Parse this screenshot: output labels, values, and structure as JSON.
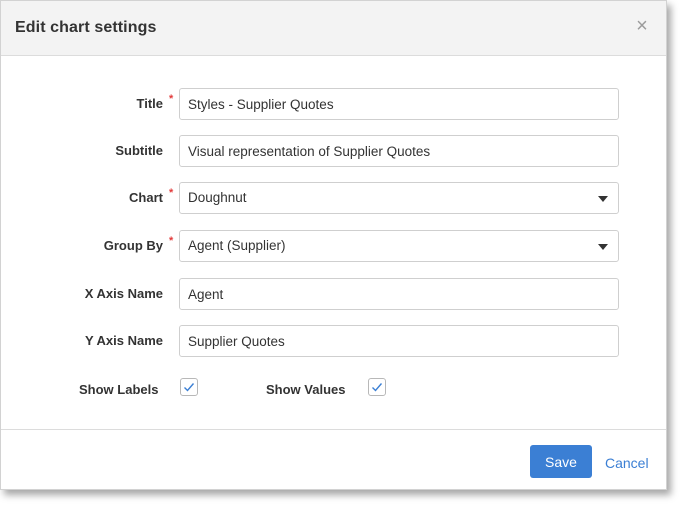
{
  "dialog": {
    "title": "Edit chart settings",
    "close_glyph": "×"
  },
  "form": {
    "title": {
      "label": "Title",
      "required": true,
      "value": "Styles - Supplier Quotes"
    },
    "subtitle": {
      "label": "Subtitle",
      "required": false,
      "value": "Visual representation of Supplier Quotes"
    },
    "chart": {
      "label": "Chart",
      "required": true,
      "value": "Doughnut"
    },
    "group_by": {
      "label": "Group By",
      "required": true,
      "value": "Agent (Supplier)"
    },
    "x_axis_name": {
      "label": "X Axis Name",
      "required": false,
      "value": "Agent"
    },
    "y_axis_name": {
      "label": "Y Axis Name",
      "required": false,
      "value": "Supplier Quotes"
    },
    "required_marker": "*",
    "show_labels": {
      "label": "Show Labels",
      "checked": true
    },
    "show_values": {
      "label": "Show Values",
      "checked": true
    }
  },
  "footer": {
    "save_label": "Save",
    "cancel_label": "Cancel"
  },
  "colors": {
    "accent": "#3b7fd4",
    "required": "#e23b3b",
    "header_bg": "#f3f3f3"
  },
  "icons": {
    "close": "close-icon",
    "dropdown": "chevron-down-icon",
    "check": "checkmark-icon"
  }
}
